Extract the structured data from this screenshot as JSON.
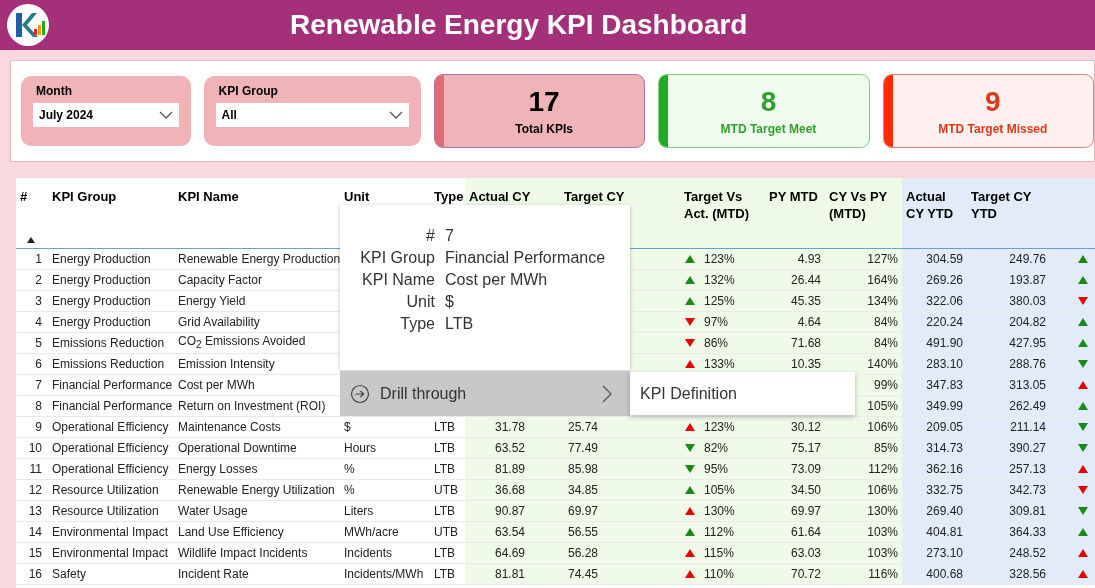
{
  "header": {
    "title": "Renewable Energy KPI Dashboard"
  },
  "filters": [
    {
      "label": "Month",
      "value": "July 2024"
    },
    {
      "label": "KPI Group",
      "value": "All"
    }
  ],
  "kpi_cards": [
    {
      "value": "17",
      "label": "Total KPIs",
      "color": "#e06b77",
      "kind": "total"
    },
    {
      "value": "8",
      "label": "MTD Target Meet",
      "color": "#22aa22",
      "kind": "met"
    },
    {
      "value": "9",
      "label": "MTD Target Missed",
      "color": "#ff2a00",
      "kind": "missed"
    }
  ],
  "table": {
    "columns": [
      "#",
      "KPI Group",
      "KPI Name",
      "Unit",
      "Type",
      "Actual CY",
      "Target CY",
      "Target Vs Act. (MTD)",
      "PY MTD",
      "CY Vs PY (MTD)",
      "Actual CY YTD",
      "Target CY YTD"
    ],
    "sort_ascending": true,
    "rows": [
      {
        "num": "1",
        "group": "Energy Production",
        "name": "Renewable Energy Production",
        "tva_mtd": {
          "up": true,
          "color": "#178a17",
          "text": "123%"
        },
        "py_mtd": "4.93",
        "cy_vs_py": "127%",
        "actual_ytd": "304.59",
        "target_ytd": "249.76",
        "column_14": {
          "up": true,
          "color": "#178a17"
        }
      },
      {
        "num": "2",
        "group": "Energy Production",
        "name": "Capacity Factor",
        "tva_mtd": {
          "up": true,
          "color": "#178a17",
          "text": "132%"
        },
        "py_mtd": "26.44",
        "cy_vs_py": "164%",
        "actual_ytd": "269.26",
        "target_ytd": "193.87",
        "column_14": {
          "up": true,
          "color": "#178a17"
        }
      },
      {
        "num": "3",
        "group": "Energy Production",
        "name": "Energy Yield",
        "tva_mtd": {
          "up": true,
          "color": "#178a17",
          "text": "125%"
        },
        "py_mtd": "45.35",
        "cy_vs_py": "134%",
        "actual_ytd": "322.06",
        "target_ytd": "380.03",
        "column_14": {
          "up": false,
          "color": "#e60000"
        }
      },
      {
        "num": "4",
        "group": "Energy Production",
        "name": "Grid Availability",
        "tva_mtd": {
          "up": false,
          "color": "#e60000",
          "text": "97%"
        },
        "py_mtd": "4.64",
        "cy_vs_py": "84%",
        "actual_ytd": "220.24",
        "target_ytd": "204.82",
        "column_14": {
          "up": true,
          "color": "#178a17"
        }
      },
      {
        "num": "5",
        "group": "Emissions Reduction",
        "name": "CO$_{2}$ Emissions Avoided",
        "tva_mtd": {
          "up": false,
          "color": "#e60000",
          "text": "86%"
        },
        "py_mtd": "71.68",
        "cy_vs_py": "84%",
        "actual_ytd": "491.90",
        "target_ytd": "427.95",
        "column_14": {
          "up": true,
          "color": "#178a17"
        }
      },
      {
        "num": "6",
        "group": "Emissions Reduction",
        "name": "Emission Intensity",
        "tva_mtd": {
          "up": true,
          "color": "#e60000",
          "text": "133%"
        },
        "py_mtd": "10.35",
        "cy_vs_py": "140%",
        "actual_ytd": "283.10",
        "target_ytd": "288.76",
        "column_14": {
          "up": false,
          "color": "#178a17"
        }
      },
      {
        "num": "7",
        "group": "Financial Performance",
        "name": "Cost per MWh",
        "cy_vs_py": "99%",
        "actual_ytd": "347.83",
        "target_ytd": "313.05",
        "column_14": {
          "up": true,
          "color": "#e60000"
        }
      },
      {
        "num": "8",
        "group": "Financial Performance",
        "name": "Return on Investment (ROI)",
        "cy_vs_py": "105%",
        "actual_ytd": "349.99",
        "target_ytd": "262.49",
        "column_14": {
          "up": true,
          "color": "#178a17"
        }
      },
      {
        "num": "9",
        "group": "Operational Efficiency",
        "name": "Maintenance Costs",
        "unit": "$",
        "type": "LTB",
        "actual_cy": "31.78",
        "target_cy": "25.74",
        "tva_mtd": {
          "up": true,
          "color": "#e60000",
          "text": "123%"
        },
        "py_mtd": "30.12",
        "cy_vs_py": "106%",
        "actual_ytd": "209.05",
        "target_ytd": "211.14",
        "column_14": {
          "up": false,
          "color": "#178a17"
        }
      },
      {
        "num": "10",
        "group": "Operational Efficiency",
        "name": "Operational Downtime",
        "unit": "Hours",
        "type": "LTB",
        "actual_cy": "63.52",
        "target_cy": "77.49",
        "tva_mtd": {
          "up": false,
          "color": "#178a17",
          "text": "82%"
        },
        "py_mtd": "75.17",
        "cy_vs_py": "85%",
        "actual_ytd": "314.73",
        "target_ytd": "390.27",
        "column_14": {
          "up": false,
          "color": "#178a17"
        }
      },
      {
        "num": "11",
        "group": "Operational Efficiency",
        "name": "Energy Losses",
        "unit": "%",
        "type": "LTB",
        "actual_cy": "81.89",
        "target_cy": "85.98",
        "tva_mtd": {
          "up": false,
          "color": "#178a17",
          "text": "95%"
        },
        "py_mtd": "73.09",
        "cy_vs_py": "112%",
        "actual_ytd": "362.16",
        "target_ytd": "257.13",
        "column_14": {
          "up": true,
          "color": "#e60000"
        }
      },
      {
        "num": "12",
        "group": "Resource Utilization",
        "name": "Renewable Energy Utilization",
        "unit": "%",
        "type": "UTB",
        "actual_cy": "36.68",
        "target_cy": "34.85",
        "tva_mtd": {
          "up": true,
          "color": "#178a17",
          "text": "105%"
        },
        "py_mtd": "34.50",
        "cy_vs_py": "106%",
        "actual_ytd": "332.75",
        "target_ytd": "342.73",
        "column_14": {
          "up": false,
          "color": "#e60000"
        }
      },
      {
        "num": "13",
        "group": "Resource Utilization",
        "name": "Water Usage",
        "unit": "Liters",
        "type": "LTB",
        "actual_cy": "90.87",
        "target_cy": "69.97",
        "tva_mtd": {
          "up": true,
          "color": "#e60000",
          "text": "130%"
        },
        "py_mtd": "69.97",
        "cy_vs_py": "130%",
        "actual_ytd": "269.40",
        "target_ytd": "309.81",
        "column_14": {
          "up": false,
          "color": "#178a17"
        }
      },
      {
        "num": "14",
        "group": "Environmental Impact",
        "name": "Land Use Efficiency",
        "unit": "MWh/acre",
        "type": "UTB",
        "actual_cy": "63.54",
        "target_cy": "56.55",
        "tva_mtd": {
          "up": true,
          "color": "#178a17",
          "text": "112%"
        },
        "py_mtd": "61.64",
        "cy_vs_py": "103%",
        "actual_ytd": "404.81",
        "target_ytd": "364.33",
        "column_14": {
          "up": true,
          "color": "#178a17"
        }
      },
      {
        "num": "15",
        "group": "Environmental Impact",
        "name": "Wildlife Impact Incidents",
        "unit": "Incidents",
        "type": "LTB",
        "actual_cy": "64.69",
        "target_cy": "56.28",
        "tva_mtd": {
          "up": true,
          "color": "#e60000",
          "text": "115%"
        },
        "py_mtd": "63.03",
        "cy_vs_py": "103%",
        "actual_ytd": "273.10",
        "target_ytd": "248.52",
        "column_14": {
          "up": true,
          "color": "#e60000"
        }
      },
      {
        "num": "16",
        "group": "Safety",
        "name": "Incident Rate",
        "unit": "Incidents/MWh",
        "type": "LTB",
        "actual_cy": "81.81",
        "target_cy": "74.45",
        "tva_mtd": {
          "up": true,
          "color": "#e60000",
          "text": "110%"
        },
        "py_mtd": "70.72",
        "cy_vs_py": "116%",
        "actual_ytd": "400.68",
        "target_ytd": "328.56",
        "column_14": {
          "up": true,
          "color": "#e60000"
        }
      }
    ]
  },
  "tooltip": {
    "fields": [
      {
        "label": "#",
        "value": "7"
      },
      {
        "label": "KPI Group",
        "value": "Financial Performance"
      },
      {
        "label": "KPI Name",
        "value": "Cost per MWh"
      },
      {
        "label": "Unit",
        "value": "$"
      },
      {
        "label": "Type",
        "value": "LTB"
      }
    ]
  },
  "context_menu": {
    "items": [
      {
        "label": "Drill through",
        "has_submenu": true
      }
    ]
  },
  "submenu": {
    "items": [
      {
        "label": "KPI Definition"
      }
    ]
  }
}
